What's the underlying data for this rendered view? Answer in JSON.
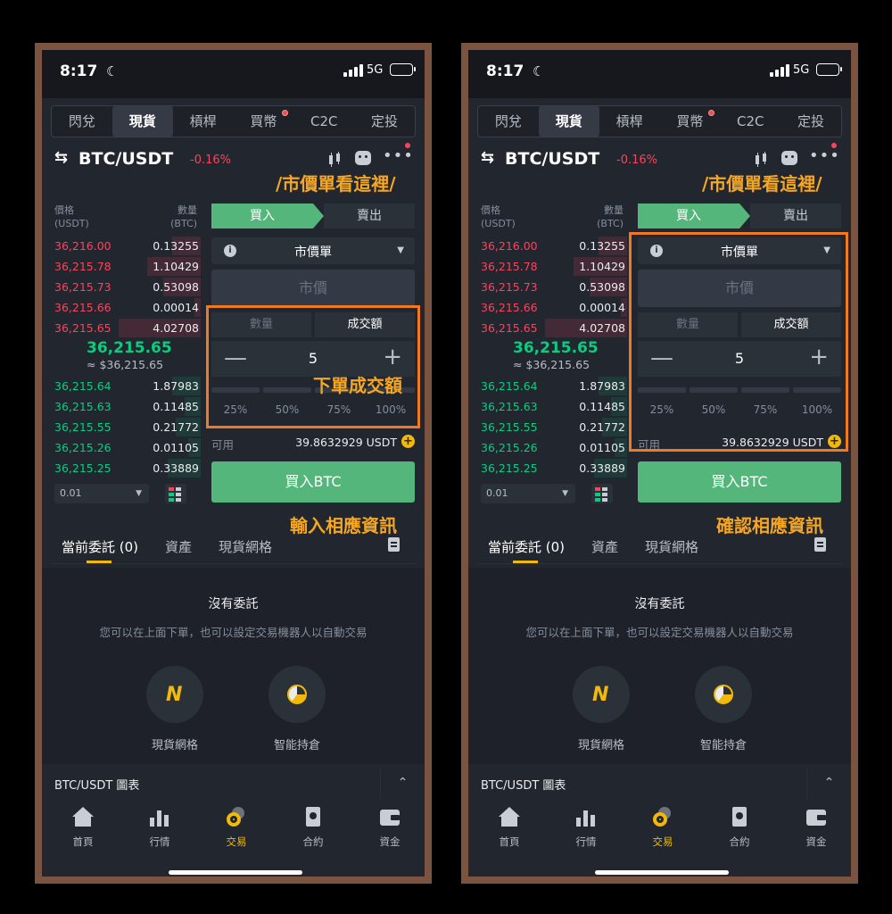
{
  "status": {
    "time": "8:17",
    "network": "5G"
  },
  "tabs": [
    "閃兌",
    "現貨",
    "槓桿",
    "買幣",
    "C2C",
    "定投"
  ],
  "pair": {
    "name": "BTC/USDT",
    "change": "-0.16%"
  },
  "orderbook": {
    "head_price": "價格",
    "head_price_unit": "(USDT)",
    "head_qty": "數量",
    "head_qty_unit": "(BTC)",
    "asks": [
      {
        "price": "36,216.00",
        "qty": "0.13255",
        "depth": 0.35
      },
      {
        "price": "36,215.78",
        "qty": "1.10429",
        "depth": 0.65
      },
      {
        "price": "36,215.73",
        "qty": "0.53098",
        "depth": 0.45
      },
      {
        "price": "36,215.66",
        "qty": "0.00014",
        "depth": 0.08
      },
      {
        "price": "36,215.65",
        "qty": "4.02708",
        "depth": 1.0
      }
    ],
    "mid_price": "36,215.65",
    "mid_usd": "≈ $36,215.65",
    "bids": [
      {
        "price": "36,215.64",
        "qty": "1.87983",
        "depth": 0.35
      },
      {
        "price": "36,215.63",
        "qty": "0.11485",
        "depth": 0.2
      },
      {
        "price": "36,215.55",
        "qty": "0.21772",
        "depth": 0.3
      },
      {
        "price": "36,215.26",
        "qty": "0.01105",
        "depth": 0.15
      },
      {
        "price": "36,215.25",
        "qty": "0.33889",
        "depth": 0.4
      }
    ],
    "precision": "0.01"
  },
  "form": {
    "buy": "買入",
    "sell": "賣出",
    "order_type": "市價單",
    "market_placeholder": "市價",
    "mode_qty": "數量",
    "mode_total": "成交額",
    "amount": "5",
    "pcts": [
      "25%",
      "50%",
      "75%",
      "100%"
    ],
    "avail_label": "可用",
    "avail_value": "39.8632929 USDT",
    "buy_button": "買入BTC"
  },
  "orders": {
    "tab_current": "當前委託 (0)",
    "tab_assets": "資產",
    "tab_grid": "現貨網格",
    "empty_title": "沒有委託",
    "empty_desc": "您可以在上面下單，也可以設定交易機器人以自動交易",
    "promo_grid": "現貨網格",
    "promo_smart": "智能持倉"
  },
  "chart_bar": {
    "title": "BTC/USDT 圖表"
  },
  "nav": [
    "首頁",
    "行情",
    "交易",
    "合約",
    "資金"
  ],
  "left_callouts": {
    "top": "/市價單看這裡/",
    "mid": "下單成交額",
    "bottom": "輸入相應資訊"
  },
  "right_callouts": {
    "top": "/市價單看這裡/",
    "bottom": "確認相應資訊"
  },
  "colors": {
    "accent": "#f0b90b",
    "buy": "#55b67b",
    "ask": "#f6465d",
    "bid": "#0ecb81",
    "highlight_border": "#f07a23"
  }
}
